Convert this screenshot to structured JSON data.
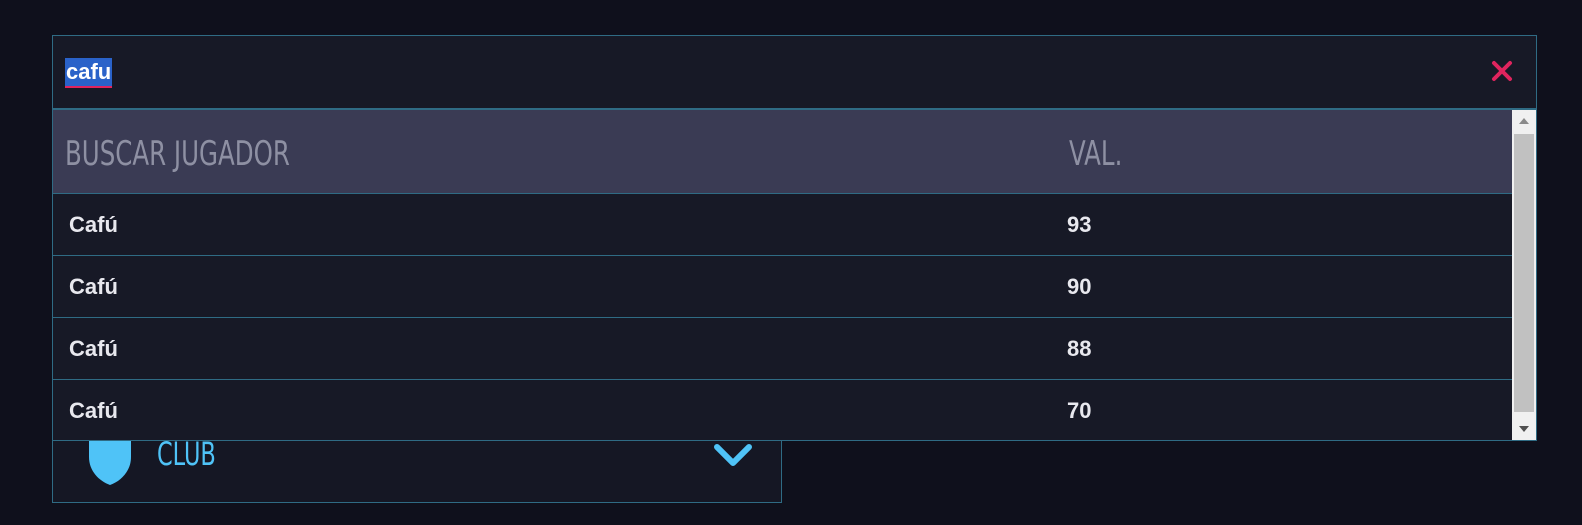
{
  "search": {
    "value": "cafu",
    "clear_icon": "close-icon",
    "clear_color": "#e0245e"
  },
  "results": {
    "header": {
      "name": "BUSCAR JUGADOR",
      "value": "VAL."
    },
    "rows": [
      {
        "name": "Cafú",
        "value": "93"
      },
      {
        "name": "Cafú",
        "value": "90"
      },
      {
        "name": "Cafú",
        "value": "88"
      },
      {
        "name": "Cafú",
        "value": "70"
      }
    ]
  },
  "club_filter": {
    "label": "CLUB",
    "icon": "shield-icon",
    "expand_icon": "chevron-down-icon",
    "accent": "#4fc3f7"
  }
}
